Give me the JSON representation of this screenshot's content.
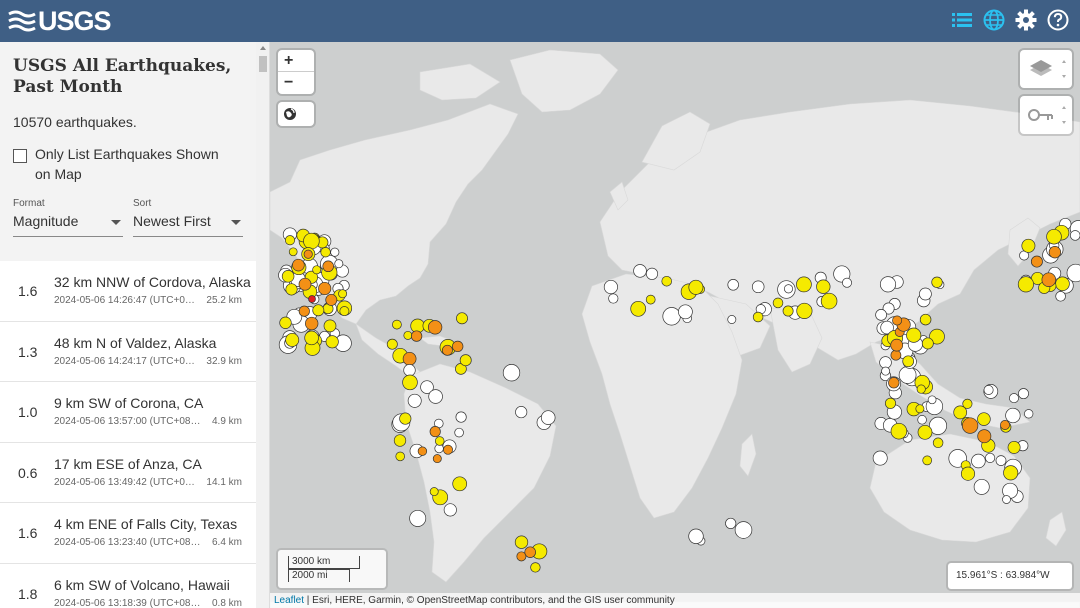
{
  "header": {
    "logo_text": "USGS",
    "icons": [
      "list-icon",
      "globe-icon",
      "gear-icon",
      "help-icon"
    ],
    "bg_color": "#3f5f85",
    "accent_color": "#2bc1f0"
  },
  "sidebar": {
    "title": "USGS All Earthquakes, Past Month",
    "count": "10570 earthquakes.",
    "checkbox_label": "Only List Earthquakes Shown on Map",
    "format_label": "Format",
    "format_value": "Magnitude",
    "sort_label": "Sort",
    "sort_value": "Newest First",
    "earthquakes": [
      {
        "mag": "1.6",
        "place": "32 km NNW of Cordova, Alaska",
        "time": "2024-05-06 14:26:47 (UTC+0…",
        "depth": "25.2 km"
      },
      {
        "mag": "1.3",
        "place": "48 km N of Valdez, Alaska",
        "time": "2024-05-06 14:24:17 (UTC+0…",
        "depth": "32.9 km"
      },
      {
        "mag": "1.0",
        "place": "9 km SW of Corona, CA",
        "time": "2024-05-06 13:57:00 (UTC+08…",
        "depth": "4.9 km"
      },
      {
        "mag": "0.6",
        "place": "17 km ESE of Anza, CA",
        "time": "2024-05-06 13:49:42 (UTC+0…",
        "depth": "14.1 km"
      },
      {
        "mag": "1.6",
        "place": "4 km ENE of Falls City, Texas",
        "time": "2024-05-06 13:23:40 (UTC+08…",
        "depth": "6.4 km"
      },
      {
        "mag": "1.8",
        "place": "6 km SW of Volcano, Hawaii",
        "time": "2024-05-06 13:18:39 (UTC+08…",
        "depth": "0.8 km"
      }
    ]
  },
  "map": {
    "zoom_in": "+",
    "zoom_out": "−",
    "scale_km": "3000 km",
    "scale_mi": "2000 mi",
    "coordinates": "15.961°S : 63.984°W",
    "attribution_link": "Leaflet",
    "attribution_text": " | Esri, HERE, Garmin, © OpenStreetMap contributors, and the GIS user community",
    "land_color": "#e9e9e9",
    "water_color": "#cdcfcf",
    "marker_colors": {
      "white": "#ffffff",
      "yellow": "#f5ea00",
      "orange": "#f39016",
      "red": "#e01f1f"
    }
  }
}
